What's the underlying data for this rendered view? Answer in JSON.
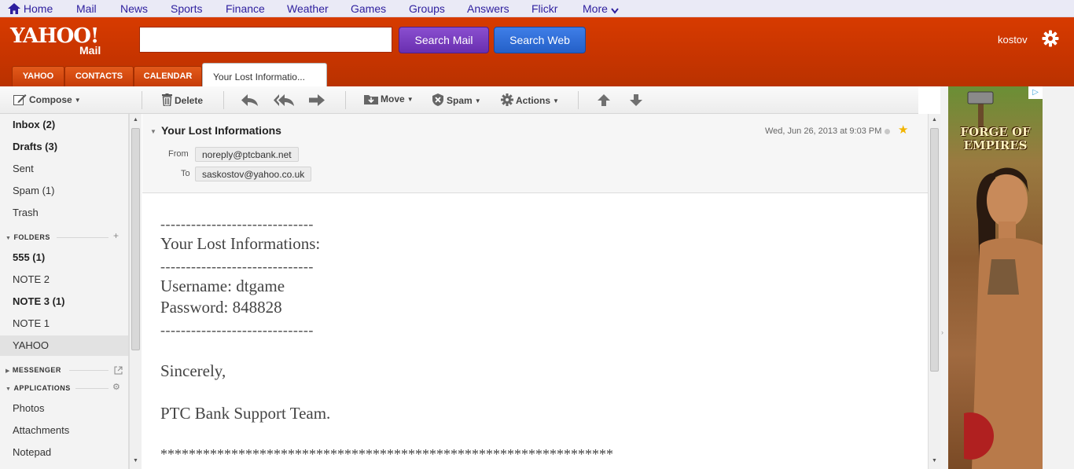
{
  "topnav": {
    "items": [
      "Home",
      "Mail",
      "News",
      "Sports",
      "Finance",
      "Weather",
      "Games",
      "Groups",
      "Answers",
      "Flickr",
      "More"
    ]
  },
  "header": {
    "logo_main": "YAHOO!",
    "logo_sub": "Mail",
    "search_value": "",
    "search_mail_label": "Search Mail",
    "search_web_label": "Search Web",
    "username": "kostov"
  },
  "tabs": {
    "yahoo": "YAHOO",
    "contacts": "CONTACTS",
    "calendar": "CALENDAR",
    "active": "Your Lost Informatio..."
  },
  "toolbar": {
    "compose": "Compose",
    "delete": "Delete",
    "move": "Move",
    "spam": "Spam",
    "actions": "Actions"
  },
  "sidebar": {
    "inbox": "Inbox (2)",
    "drafts": "Drafts (3)",
    "sent": "Sent",
    "spam": "Spam (1)",
    "trash": "Trash",
    "folders_head": "FOLDERS",
    "folders": [
      "555 (1)",
      "NOTE 2",
      "NOTE 3 (1)",
      "NOTE 1",
      "YAHOO"
    ],
    "messenger_head": "MESSENGER",
    "applications_head": "APPLICATIONS",
    "apps": [
      "Photos",
      "Attachments",
      "Notepad"
    ]
  },
  "message": {
    "subject": "Your Lost Informations",
    "from_label": "From",
    "from": "noreply@ptcbank.net",
    "to_label": "To",
    "to": "saskostov@yahoo.co.uk",
    "date": "Wed, Jun 26, 2013 at 9:03 PM",
    "body": {
      "dashes": "------------------------------",
      "heading": "Your Lost Informations:",
      "username": "Username: dtgame",
      "password": "Password: 848828",
      "closing": "Sincerely,",
      "signature": "PTC Bank Support Team.",
      "stars": "****************************************************************"
    }
  },
  "ad": {
    "title": "FORGE OF EMPIRES",
    "badge": "▷"
  },
  "colors": {
    "header_red": "#c63400",
    "nav_blue": "#2d1e9e",
    "search_mail_purple": "#7a3fc0",
    "search_web_blue": "#3070d8",
    "star_yellow": "#f2b400"
  }
}
